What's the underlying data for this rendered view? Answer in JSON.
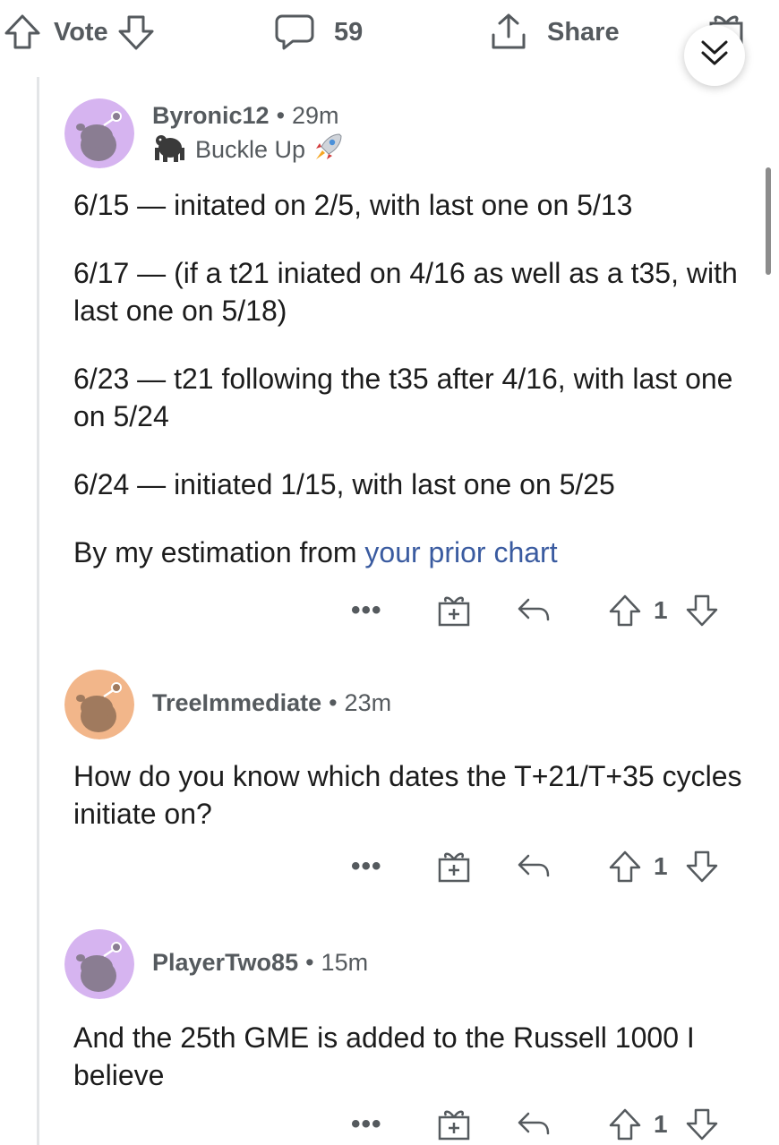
{
  "topbar": {
    "vote_label": "Vote",
    "comment_count": "59",
    "share_label": "Share"
  },
  "icons": {
    "upvote": "arrow-up-outline-icon",
    "downvote": "arrow-down-outline-icon",
    "comment": "speech-bubble-icon",
    "share": "share-upload-icon",
    "gift": "gift-award-icon",
    "collapse": "double-chevron-down-icon",
    "reply": "reply-arrow-icon",
    "more": "ellipsis-icon"
  },
  "comments": [
    {
      "username": "Byronic12",
      "separator": "•",
      "time": "29m",
      "flair": "Buckle Up",
      "avatar_color": "#d6b4f0",
      "paragraphs": [
        "6/15 — initated on 2/5, with last one on 5/13",
        "6/17 — (if a t21 iniated on 4/16 as well as a t35, with last one on 5/18)",
        "6/23 — t21 following the t35 after 4/16, with last one on 5/24",
        "6/24 — initiated 1/15, with last one on 5/25"
      ],
      "link_prefix": "By my estimation from ",
      "link_text": "your prior chart",
      "actions": {
        "more": "•••",
        "vote_count": "1"
      }
    },
    {
      "username": "TreeImmediate",
      "separator": "•",
      "time": "23m",
      "avatar_color": "#f2b68a",
      "paragraphs": [
        "How do you know which dates the T+21/T+35 cycles initiate on?"
      ],
      "actions": {
        "more": "•••",
        "vote_count": "1"
      }
    },
    {
      "username": "PlayerTwo85",
      "separator": "•",
      "time": "15m",
      "avatar_color": "#d6b4f0",
      "paragraphs": [
        "And the 25th GME is added to the Russell 1000 I believe"
      ],
      "actions": {
        "more": "•••",
        "vote_count": "1"
      }
    }
  ],
  "colors": {
    "meta_text": "#555a5e",
    "body_text": "#1c1c1c",
    "link": "#3a5ba0",
    "thread_line": "#e3e5e7"
  }
}
